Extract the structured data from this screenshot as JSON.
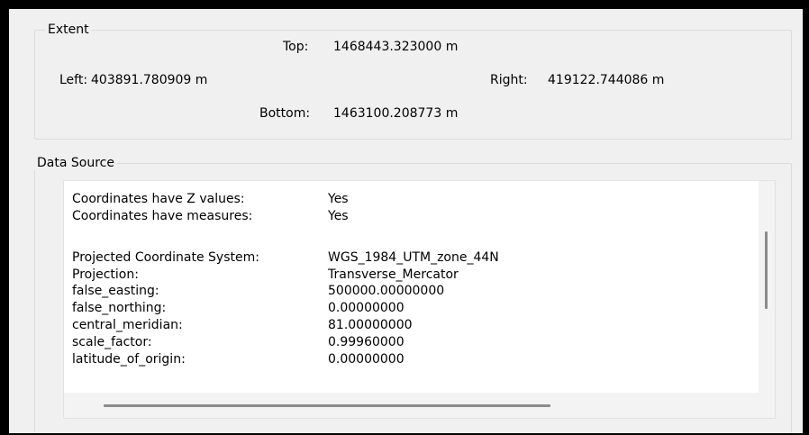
{
  "extent": {
    "legend": "Extent",
    "top_label": "Top:",
    "top_value": "1468443.323000 m",
    "left_label": "Left:",
    "left_value": "403891.780909 m",
    "right_label": "Right:",
    "right_value": "419122.744086 m",
    "bottom_label": "Bottom:",
    "bottom_value": "1463100.208773 m"
  },
  "data_source": {
    "legend": "Data Source",
    "rows": [
      {
        "key": "Coordinates have Z values:",
        "value": "Yes"
      },
      {
        "key": "Coordinates have measures:",
        "value": "Yes"
      },
      {
        "key": "Projected Coordinate System:",
        "value": "WGS_1984_UTM_zone_44N"
      },
      {
        "key": "Projection:",
        "value": "Transverse_Mercator"
      },
      {
        "key": "false_easting:",
        "value": "500000.00000000"
      },
      {
        "key": "false_northing:",
        "value": "0.00000000"
      },
      {
        "key": "central_meridian:",
        "value": "81.00000000"
      },
      {
        "key": "scale_factor:",
        "value": "0.99960000"
      },
      {
        "key": "latitude_of_origin:",
        "value": "0.00000000"
      }
    ]
  }
}
